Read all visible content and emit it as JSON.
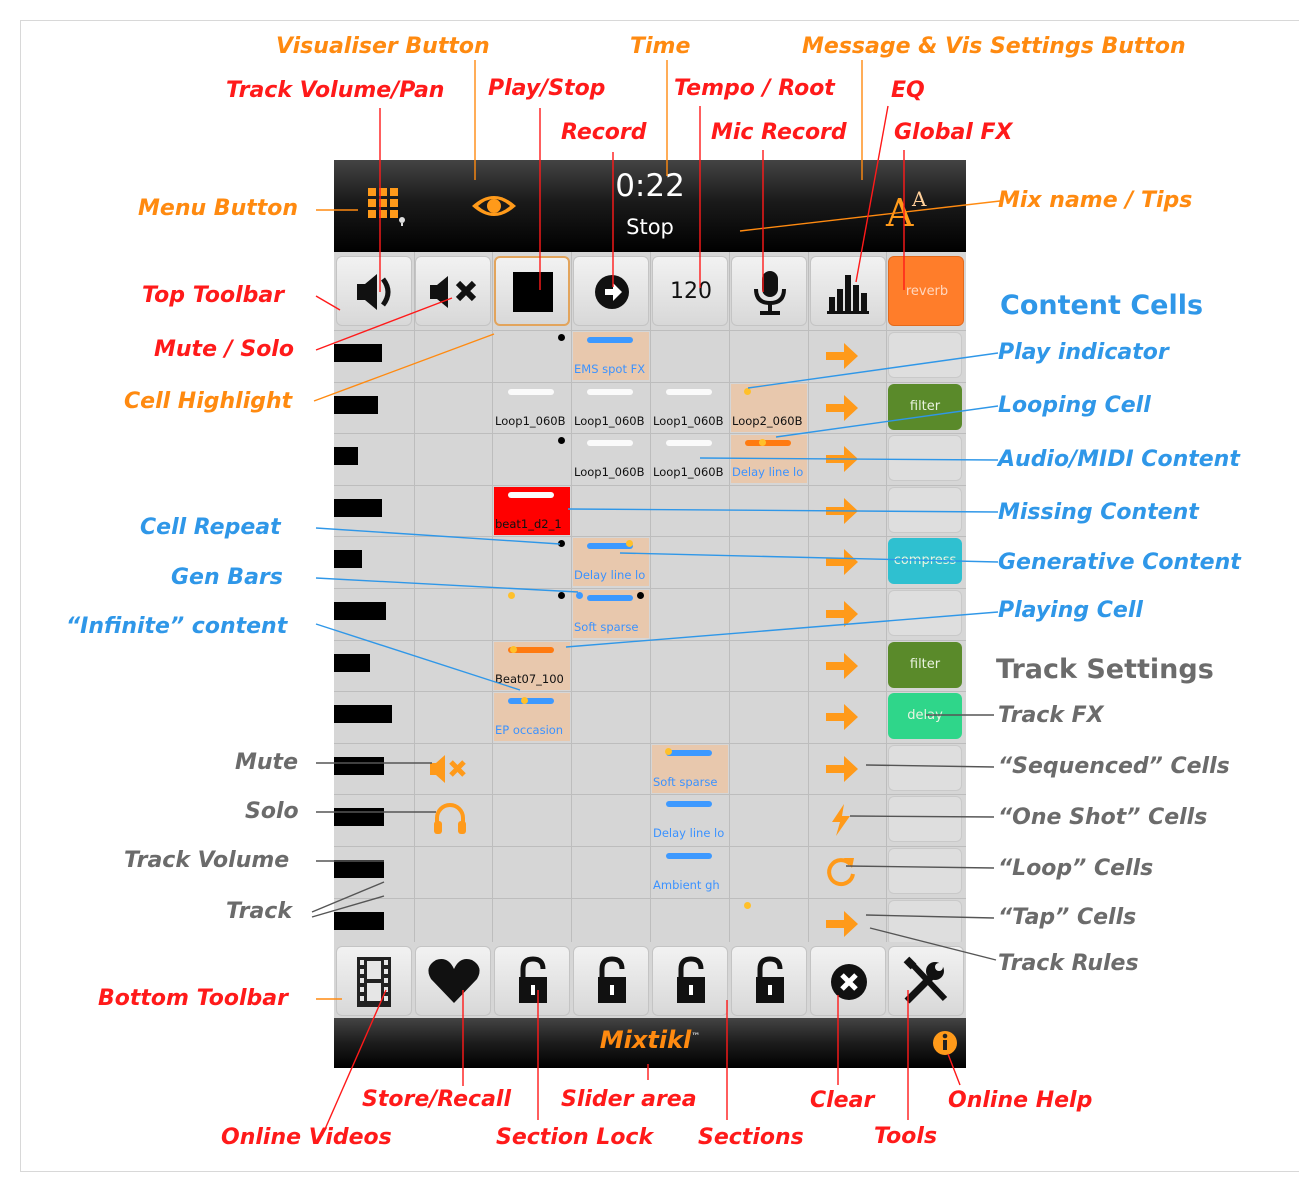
{
  "app": {
    "time": "0:22",
    "status": "Stop",
    "tempo": "120",
    "brand": "Mixtikl",
    "brand_tm": "™",
    "colors": {
      "accent": "#ff8a10",
      "reverb": "#ff7d2a",
      "filter": "#5a8a2a",
      "compress": "#2fc0d0",
      "delay": "#2fd68a",
      "missing": "#ff0000",
      "content": "#e8c8ad"
    },
    "top_toolbar": [
      {
        "icon": "speaker-icon"
      },
      {
        "icon": "mute-icon"
      },
      {
        "icon": "stop-icon"
      },
      {
        "icon": "record-icon"
      },
      {
        "label": "120"
      },
      {
        "icon": "microphone-icon"
      },
      {
        "icon": "eq-bars-icon"
      },
      {
        "label": "reverb"
      }
    ],
    "bottom_toolbar": [
      {
        "icon": "film-icon"
      },
      {
        "icon": "heart-icon"
      },
      {
        "icon": "lock-icon"
      },
      {
        "icon": "lock-icon"
      },
      {
        "icon": "lock-icon"
      },
      {
        "icon": "lock-icon"
      },
      {
        "icon": "clear-icon"
      },
      {
        "icon": "tools-icon"
      }
    ],
    "tracks": [
      {
        "volume_pct": 60,
        "cells": [
          {
            "col": 3,
            "label": "EMS spot FX",
            "kind": "content",
            "bar": "blue"
          }
        ],
        "rule": "tap-arrow",
        "fx": ""
      },
      {
        "volume_pct": 55,
        "cells": [
          {
            "col": 2,
            "label": "Loop1_060B",
            "kind": "plain",
            "bar": "white"
          },
          {
            "col": 3,
            "label": "Loop1_060B",
            "kind": "plain",
            "bar": "white"
          },
          {
            "col": 4,
            "label": "Loop1_060B",
            "kind": "plain",
            "bar": "white"
          },
          {
            "col": 5,
            "label": "Loop2_060B",
            "kind": "content",
            "bar": "none"
          }
        ],
        "rule": "tap-arrow",
        "fx": "filter"
      },
      {
        "volume_pct": 30,
        "cells": [
          {
            "col": 3,
            "label": "Loop1_060B",
            "kind": "plain",
            "bar": "white"
          },
          {
            "col": 4,
            "label": "Loop1_060B",
            "kind": "plain",
            "bar": "white"
          },
          {
            "col": 5,
            "label": "Delay line lo",
            "kind": "content",
            "bar": "orange"
          }
        ],
        "rule": "tap-arrow",
        "fx": ""
      },
      {
        "volume_pct": 60,
        "cells": [
          {
            "col": 2,
            "label": "beat1_d2_1",
            "kind": "missing",
            "bar": "white"
          }
        ],
        "rule": "tap-arrow",
        "fx": ""
      },
      {
        "volume_pct": 35,
        "cells": [
          {
            "col": 3,
            "label": "Delay line lo",
            "kind": "content",
            "bar": "blue"
          }
        ],
        "rule": "tap-arrow",
        "fx": "compress"
      },
      {
        "volume_pct": 65,
        "cells": [
          {
            "col": 3,
            "label": "Soft sparse",
            "kind": "content",
            "bar": "blue"
          }
        ],
        "rule": "tap-arrow",
        "fx": ""
      },
      {
        "volume_pct": 45,
        "cells": [
          {
            "col": 2,
            "label": "Beat07_100",
            "kind": "content",
            "bar": "orange"
          }
        ],
        "rule": "tap-arrow",
        "fx": "filter"
      },
      {
        "volume_pct": 72,
        "cells": [
          {
            "col": 2,
            "label": "EP occasion",
            "kind": "content",
            "bar": "blue"
          }
        ],
        "rule": "tap-arrow",
        "fx": "delay"
      },
      {
        "volume_pct": 62,
        "cells": [
          {
            "col": 4,
            "label": "Soft sparse",
            "kind": "content",
            "bar": "blue"
          }
        ],
        "rule": "tap-arrow",
        "fx": ""
      },
      {
        "volume_pct": 62,
        "cells": [
          {
            "col": 4,
            "label": "Delay line lo",
            "kind": "plain",
            "bar": "blue"
          }
        ],
        "rule": "one-shot-bolt",
        "fx": ""
      },
      {
        "volume_pct": 62,
        "cells": [
          {
            "col": 4,
            "label": "Ambient gh",
            "kind": "plain",
            "bar": "blue"
          }
        ],
        "rule": "loop-arrow",
        "fx": ""
      },
      {
        "volume_pct": 62,
        "cells": [],
        "rule": "tap-arrow",
        "fx": ""
      }
    ]
  },
  "annotations": {
    "visualiser_button": "Visualiser Button",
    "time": "Time",
    "message_vis_settings": "Message & Vis Settings Button",
    "track_volume_pan": "Track Volume/Pan",
    "play_stop": "Play/Stop",
    "tempo_root": "Tempo / Root",
    "eq": "EQ",
    "record": "Record",
    "mic_record": "Mic Record",
    "global_fx": "Global FX",
    "menu_button": "Menu Button",
    "mix_name_tips": "Mix name / Tips",
    "top_toolbar": "Top Toolbar",
    "mute_solo": "Mute / Solo",
    "cell_highlight": "Cell Highlight",
    "cell_repeat": "Cell Repeat",
    "gen_bars": "Gen Bars",
    "infinite_content": "“Infinite” content",
    "mute": "Mute",
    "solo": "Solo",
    "track_volume": "Track Volume",
    "track": "Track",
    "bottom_toolbar": "Bottom Toolbar",
    "content_cells": "Content Cells",
    "play_indicator": "Play indicator",
    "looping_cell": "Looping Cell",
    "audio_midi_content": "Audio/MIDI Content",
    "missing_content": "Missing Content",
    "generative_content": "Generative Content",
    "playing_cell": "Playing Cell",
    "track_settings": "Track Settings",
    "track_fx": "Track FX",
    "sequenced_cells": "“Sequenced” Cells",
    "one_shot_cells": "“One Shot” Cells",
    "loop_cells": "“Loop” Cells",
    "tap_cells": "“Tap” Cells",
    "track_rules": "Track Rules",
    "store_recall": "Store/Recall",
    "slider_area": "Slider area",
    "clear": "Clear",
    "online_help": "Online Help",
    "online_videos": "Online Videos",
    "section_lock": "Section Lock",
    "sections": "Sections",
    "tools": "Tools"
  }
}
